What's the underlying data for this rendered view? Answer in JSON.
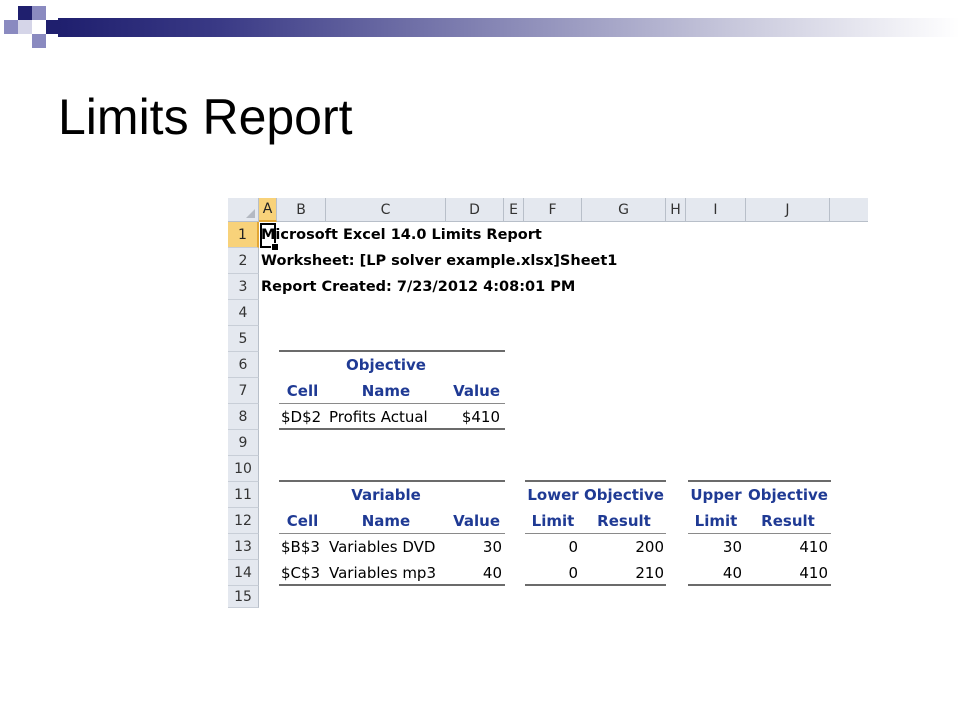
{
  "slide": {
    "title": "Limits Report",
    "colors": {
      "navy": "#1f1f6e",
      "periwinkle": "#8a8ac0",
      "header_text": "#1f3a94"
    }
  },
  "sheet": {
    "columns": [
      "A",
      "B",
      "C",
      "D",
      "E",
      "F",
      "G",
      "H",
      "I",
      "J"
    ],
    "rows": [
      "1",
      "2",
      "3",
      "4",
      "5",
      "6",
      "7",
      "8",
      "9",
      "10",
      "11",
      "12",
      "13",
      "14",
      "15"
    ],
    "selected_cell": "A1",
    "header_lines": [
      "Microsoft Excel 14.0 Limits Report",
      "Worksheet: [LP solver example.xlsx]Sheet1",
      "Report Created: 7/23/2012 4:08:01 PM"
    ],
    "objective": {
      "group_header": "Objective",
      "columns": [
        "Cell",
        "Name",
        "Value"
      ],
      "rows": [
        {
          "cell": "$D$2",
          "name": "Profits Actual",
          "value": "$410"
        }
      ]
    },
    "variable": {
      "group_header": "Variable",
      "columns": [
        "Cell",
        "Name",
        "Value"
      ],
      "rows": [
        {
          "cell": "$B$3",
          "name": "Variables DVD",
          "value": "30"
        },
        {
          "cell": "$C$3",
          "name": "Variables mp3",
          "value": "40"
        }
      ]
    },
    "lower": {
      "header_top": [
        "Lower",
        "Objective"
      ],
      "header_bottom": [
        "Limit",
        "Result"
      ],
      "rows": [
        {
          "limit": "0",
          "result": "200"
        },
        {
          "limit": "0",
          "result": "210"
        }
      ]
    },
    "upper": {
      "header_top": [
        "Upper",
        "Objective"
      ],
      "header_bottom": [
        "Limit",
        "Result"
      ],
      "rows": [
        {
          "limit": "30",
          "result": "410"
        },
        {
          "limit": "40",
          "result": "410"
        }
      ]
    }
  }
}
